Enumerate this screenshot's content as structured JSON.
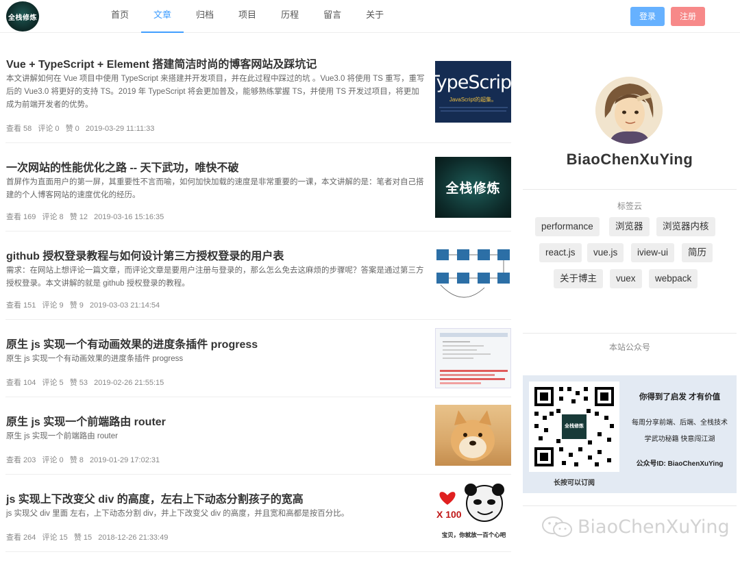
{
  "header": {
    "logo_text": "全栈修炼",
    "nav": [
      {
        "label": "首页"
      },
      {
        "label": "文章"
      },
      {
        "label": "归档"
      },
      {
        "label": "项目"
      },
      {
        "label": "历程"
      },
      {
        "label": "留言"
      },
      {
        "label": "关于"
      }
    ],
    "active_nav": "文章",
    "login_label": "登录",
    "register_label": "注册",
    "colors": {
      "accent": "#409eff",
      "login": "#66b1ff",
      "register": "#f78989"
    }
  },
  "articles": [
    {
      "title": "Vue + TypeScript + Element 搭建简洁时尚的博客网站及踩坑记",
      "desc": "本文讲解如何在 Vue 项目中使用 TypeScript 来搭建并开发项目，并在此过程中踩过的坑 。Vue3.0 将使用 TS 重写，重写后的 Vue3.0 将更好的支持 TS。2019 年 TypeScript 将会更加普及，能够熟练掌握 TS，并使用 TS 开发过项目，将更加成为前端开发者的优势。",
      "views": "查看 58",
      "comments": "评论 0",
      "likes": "赞 0",
      "date": "2019-03-29 11:11:33",
      "thumb": {
        "type": "typescript",
        "big": "TypeScript",
        "sub": "JavaScript的超集。"
      }
    },
    {
      "title": "一次网站的性能优化之路 -- 天下武功，唯快不破",
      "desc": "首屏作为直面用户的第一屏，其重要性不言而喻，如何加快加载的速度是非常重要的一课，本文讲解的是：笔者对自己搭建的个人博客网站的速度优化的经历。",
      "views": "查看 169",
      "comments": "评论 8",
      "likes": "赞 12",
      "date": "2019-03-16 15:16:35",
      "thumb": {
        "type": "dark",
        "text": "全栈修炼"
      }
    },
    {
      "title": "github 授权登录教程与如何设计第三方授权登录的用户表",
      "desc": "需求：在网站上想评论一篇文章，而评论文章是要用户注册与登录的，那么怎么免去这麻烦的步骤呢？答案是通过第三方授权登录。本文讲解的就是 github 授权登录的教程。",
      "views": "查看 151",
      "comments": "评论 9",
      "likes": "赞 9",
      "date": "2019-03-03 21:14:54",
      "thumb": {
        "type": "diagram"
      }
    },
    {
      "title": "原生 js 实现一个有动画效果的进度条插件 progress",
      "desc": "原生 js 实现一个有动画效果的进度条插件 progress",
      "views": "查看 104",
      "comments": "评论 5",
      "likes": "赞 53",
      "date": "2019-02-26 21:55:15",
      "thumb": {
        "type": "progress"
      }
    },
    {
      "title": "原生 js 实现一个前端路由 router",
      "desc": "原生 js 实现一个前端路由 router",
      "views": "查看 203",
      "comments": "评论 0",
      "likes": "赞 8",
      "date": "2019-01-29 17:02:31",
      "thumb": {
        "type": "dog"
      }
    },
    {
      "title": "js 实现上下改变父 div 的高度，左右上下动态分割孩子的宽高",
      "desc": "js 实现父 div 里面 左右，上下动态分割 div，并上下改变父 div 的高度，并且宽和高都是按百分比。",
      "views": "查看 264",
      "comments": "评论 15",
      "likes": "赞 15",
      "date": "2018-12-26 21:33:49",
      "thumb": {
        "type": "meme",
        "big": "X 100",
        "caption": "宝贝，你就放一百个心吧"
      }
    }
  ],
  "sidebar": {
    "username": "BiaoChenXuYing",
    "tags_title": "标签云",
    "tags": [
      "performance",
      "浏览器",
      "浏览器内核",
      "react.js",
      "vue.js",
      "iview-ui",
      "简历",
      "关于博主",
      "vuex",
      "webpack"
    ],
    "wechat_title": "本站公众号",
    "qr": {
      "line1": "你得到了启发 才有价值",
      "line2": "每周分享前端、后端、全栈技术",
      "line3": "学武功秘籍 快意闯江湖",
      "line4": "公众号ID: BiaoChenXuYing",
      "caption": "长按可以订阅",
      "center_text": "全栈修炼"
    },
    "watermark": "BiaoChenXuYing"
  }
}
